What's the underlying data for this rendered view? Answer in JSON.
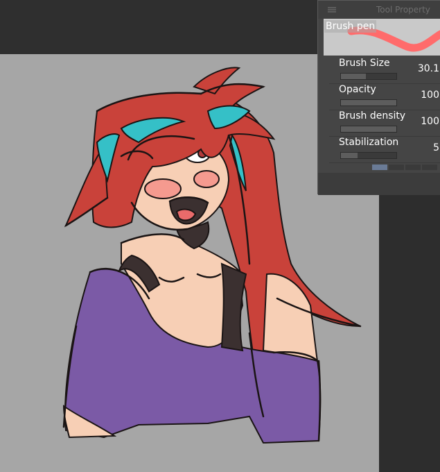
{
  "tool_property_panel": {
    "title": "Tool Property",
    "brush_name": "Brush pen",
    "stroke_color": "#ff6b6b",
    "properties": [
      {
        "label": "Brush Size",
        "value": "30.1",
        "fill": 0.45
      },
      {
        "label": "Opacity",
        "value": "100",
        "fill": 1.0
      },
      {
        "label": "Brush density",
        "value": "100",
        "fill": 1.0
      },
      {
        "label": "Stabilization",
        "value": "5",
        "fill": 0.3
      }
    ]
  },
  "canvas": {
    "background": "#a6a6a6",
    "palette": {
      "hair": "#c9423a",
      "hair_highlight": "#35c0c7",
      "skin": "#f7cfb5",
      "blush": "#f59a8f",
      "shirt": "#7b5aa6",
      "top": "#3b3030",
      "line": "#1a1414"
    }
  }
}
